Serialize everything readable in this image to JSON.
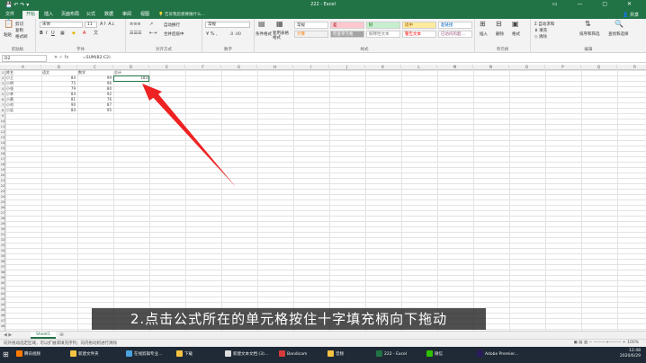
{
  "window": {
    "title": "222 - Excel",
    "share_label": "共享"
  },
  "tabs": [
    "文件",
    "开始",
    "插入",
    "页面布局",
    "公式",
    "数据",
    "审阅",
    "视图"
  ],
  "tell_me": "告诉我您想要做什么…",
  "ribbon": {
    "clipboard": {
      "paste": "粘贴",
      "cut": "剪切",
      "copy": "复制",
      "format_painter": "格式刷",
      "label": "剪贴板"
    },
    "font": {
      "name": "宋体",
      "size": "11",
      "label": "字体"
    },
    "alignment": {
      "wrap": "自动换行",
      "merge": "合并后居中",
      "label": "对齐方式"
    },
    "number": {
      "format": "常规",
      "label": "数字"
    },
    "styles": {
      "conditional": "条件格式",
      "table_format": "套用表格格式",
      "cells": [
        {
          "label": "常规",
          "bg": "#ffffff",
          "fg": "#333333"
        },
        {
          "label": "差",
          "bg": "#ffc7ce",
          "fg": "#9c0006"
        },
        {
          "label": "好",
          "bg": "#c6efce",
          "fg": "#006100"
        },
        {
          "label": "适中",
          "bg": "#ffeb9c",
          "fg": "#9c5700"
        },
        {
          "label": "超链接",
          "bg": "#ffffff",
          "fg": "#0563c1"
        },
        {
          "label": "计算",
          "bg": "#f2f2f2",
          "fg": "#fa7d00"
        },
        {
          "label": "检查单元格",
          "bg": "#a5a5a5",
          "fg": "#ffffff"
        },
        {
          "label": "解释性文本",
          "bg": "#ffffff",
          "fg": "#7f7f7f"
        },
        {
          "label": "警告文本",
          "bg": "#ffffff",
          "fg": "#ff0000"
        },
        {
          "label": "已访问的超…",
          "bg": "#ffffff",
          "fg": "#954f72"
        }
      ],
      "label": "样式"
    },
    "cells_group": {
      "insert": "插入",
      "delete": "删除",
      "format": "格式",
      "label": "单元格"
    },
    "editing": {
      "autosum": "自动求和",
      "fill": "填充",
      "clear": "清除",
      "sort": "排序和筛选",
      "find": "查找和选择",
      "label": "编辑"
    }
  },
  "formula_bar": {
    "name_box": "D2",
    "formula": "=SUM(B2:C2)"
  },
  "sheet": {
    "columns": [
      "A",
      "B",
      "C",
      "D",
      "E",
      "F",
      "G",
      "H",
      "I",
      "J",
      "K",
      "L",
      "M",
      "N",
      "O",
      "P",
      "Q",
      "R"
    ],
    "header": [
      "姓名",
      "语文",
      "数学",
      "总计"
    ],
    "rows": [
      [
        "小王",
        "84",
        "99",
        "183"
      ],
      [
        "小明",
        "75",
        "96",
        ""
      ],
      [
        "小张",
        "79",
        "80",
        ""
      ],
      [
        "小李",
        "84",
        "92",
        ""
      ],
      [
        "小黄",
        "81",
        "76",
        ""
      ],
      [
        "小刘",
        "90",
        "87",
        ""
      ],
      [
        "小吴",
        "84",
        "95",
        ""
      ]
    ],
    "row_count": 48
  },
  "sheet_tab": "Sheet1",
  "status": {
    "message": "向外拖动选定区域，可以扩展或填充序列；向内拖动则进行清除",
    "zoom": "100%"
  },
  "subtitle": "2.点击公式所在的单元格按住十字填充柄向下拖动",
  "taskbar": {
    "items": [
      {
        "label": "腾讯视频",
        "color": "#ff7a00"
      },
      {
        "label": "新建文件夹",
        "color": "#f5c342"
      },
      {
        "label": "在线剪辑专业...",
        "color": "#4aa3df"
      },
      {
        "label": "下载",
        "color": "#f5c342"
      },
      {
        "label": "新建文本文档 (3)...",
        "color": "#dddddd"
      },
      {
        "label": "Bandicam",
        "color": "#d83b3b"
      },
      {
        "label": "音频",
        "color": "#f5c342"
      },
      {
        "label": "222 - Excel",
        "color": "#217346"
      },
      {
        "label": "微信",
        "color": "#2dc100"
      },
      {
        "label": "Adobe Premier...",
        "color": "#2a1a5e"
      }
    ],
    "time": "12:48",
    "date": "2020/6/29"
  }
}
